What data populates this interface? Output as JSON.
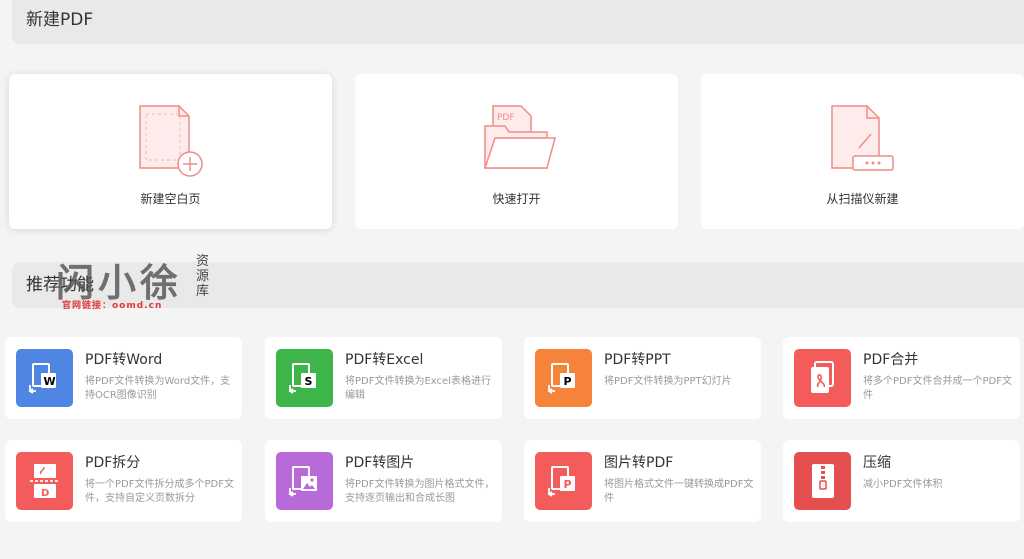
{
  "header": {
    "title": "新建PDF"
  },
  "create_options": [
    {
      "label": "新建空白页"
    },
    {
      "label": "快速打开",
      "icon_text": "PDF"
    },
    {
      "label": "从扫描仪新建"
    }
  ],
  "recommended": {
    "title": "推荐功能"
  },
  "tools": [
    {
      "title": "PDF转Word",
      "desc": "将PDF文件转换为Word文件，支持OCR图像识别",
      "color": "#4f86e3",
      "icon": "word-icon"
    },
    {
      "title": "PDF转Excel",
      "desc": "将PDF文件转换为Excel表格进行编辑",
      "color": "#3db54a",
      "icon": "excel-icon"
    },
    {
      "title": "PDF转PPT",
      "desc": "将PDF文件转换为PPT幻灯片",
      "color": "#f5833a",
      "icon": "ppt-icon"
    },
    {
      "title": "PDF合并",
      "desc": "将多个PDF文件合并成一个PDF文件",
      "color": "#f45b5b",
      "icon": "merge-icon"
    },
    {
      "title": "PDF拆分",
      "desc": "将一个PDF文件拆分成多个PDF文件，支持自定义页数拆分",
      "color": "#f45b5b",
      "icon": "split-icon"
    },
    {
      "title": "PDF转图片",
      "desc": "将PDF文件转换为图片格式文件，支持逐页输出和合成长图",
      "color": "#b96ad9",
      "icon": "image-icon"
    },
    {
      "title": "图片转PDF",
      "desc": "将图片格式文件一键转换成PDF文件",
      "color": "#f45b5b",
      "icon": "image-to-pdf-icon"
    },
    {
      "title": "压缩",
      "desc": "减小PDF文件体积",
      "color": "#e64f4f",
      "icon": "compress-icon"
    }
  ],
  "watermark": {
    "main": "闪小徐",
    "side": "资源库",
    "sub": "官网链接：oomd.cn"
  }
}
